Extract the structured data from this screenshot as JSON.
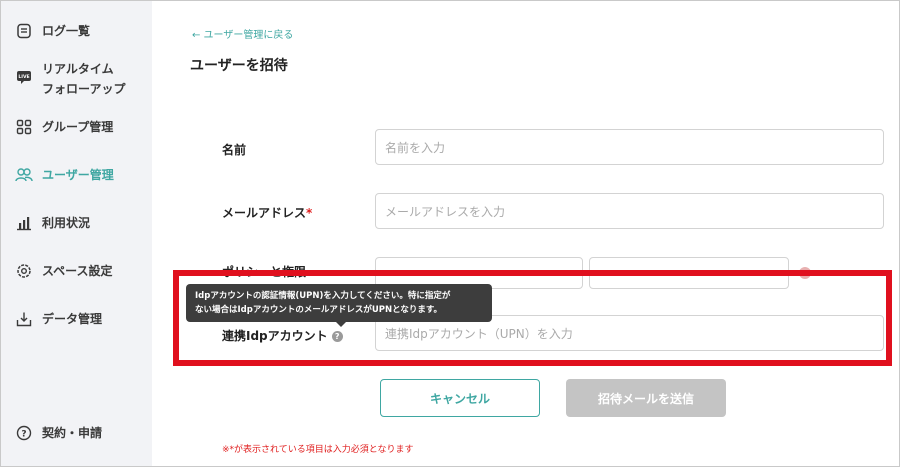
{
  "sidebar": {
    "items": [
      {
        "label": "ログ一覧",
        "icon": "document-list-icon"
      },
      {
        "label": "リアルタイム\nフォローアップ",
        "icon": "live-badge-icon"
      },
      {
        "label": "グループ管理",
        "icon": "grid-icon"
      },
      {
        "label": "ユーザー管理",
        "icon": "users-icon",
        "active": true
      },
      {
        "label": "利用状況",
        "icon": "bar-chart-icon"
      },
      {
        "label": "スペース設定",
        "icon": "gear-icon"
      },
      {
        "label": "データ管理",
        "icon": "download-tray-icon"
      }
    ],
    "footer": {
      "label": "契約・申請",
      "icon": "help-circle-icon"
    }
  },
  "main": {
    "back_link": "← ユーザー管理に戻る",
    "title": "ユーザーを招待",
    "form": {
      "name_label": "名前",
      "name_placeholder": "名前を入力",
      "email_label": "メールアドレス",
      "email_required_mark": "*",
      "email_placeholder": "メールアドレスを入力",
      "partial_label": "ポリシーと権限",
      "idp_label": "連携Idpアカウント",
      "idp_help": "?",
      "idp_placeholder": "連携Idpアカウント（UPN）を入力"
    },
    "tooltip": {
      "line1": "Idpアカウントの認証情報(UPN)を入力してください。特に指定が",
      "line2": "ない場合はIdpアカウントのメールアドレスがUPNとなります。"
    },
    "buttons": {
      "cancel": "キャンセル",
      "send": "招待メールを送信"
    },
    "footnote": "※*が表示されている項目は入力必須となります"
  },
  "colors": {
    "accent": "#3fa7a2",
    "required": "#e02020",
    "highlight": "#e0101e",
    "disabled": "#c4c4c4"
  }
}
